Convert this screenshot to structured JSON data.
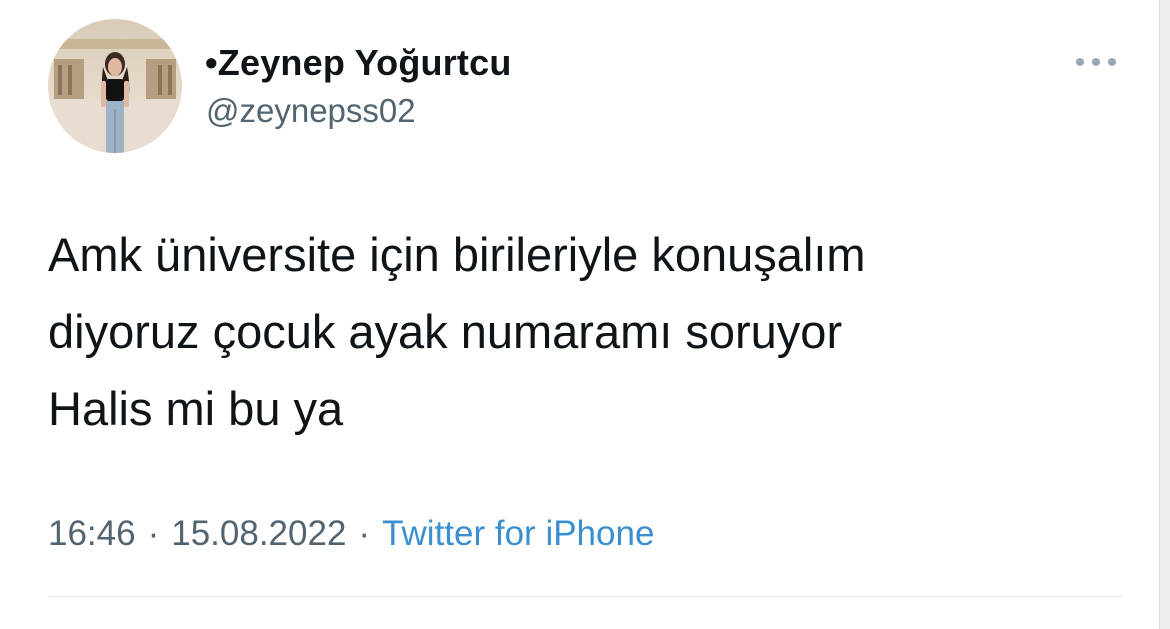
{
  "tweet": {
    "author": {
      "display_name": "•Zeynep Yoğurtcu",
      "handle": "@zeynepss02",
      "avatar_icon": "profile-photo"
    },
    "more_icon": "more-horizontal-icon",
    "text_lines": [
      "Amk üniversite için birileriyle konuşalım",
      "diyoruz çocuk ayak numaramı soruyor",
      "Halis mi bu ya"
    ],
    "time": "16:46",
    "separator": "·",
    "date": "15.08.2022",
    "source": "Twitter for iPhone"
  },
  "colors": {
    "text_primary": "#0f1419",
    "text_secondary": "#536471",
    "link": "#3a8fd0",
    "divider": "#dfe3e6"
  }
}
